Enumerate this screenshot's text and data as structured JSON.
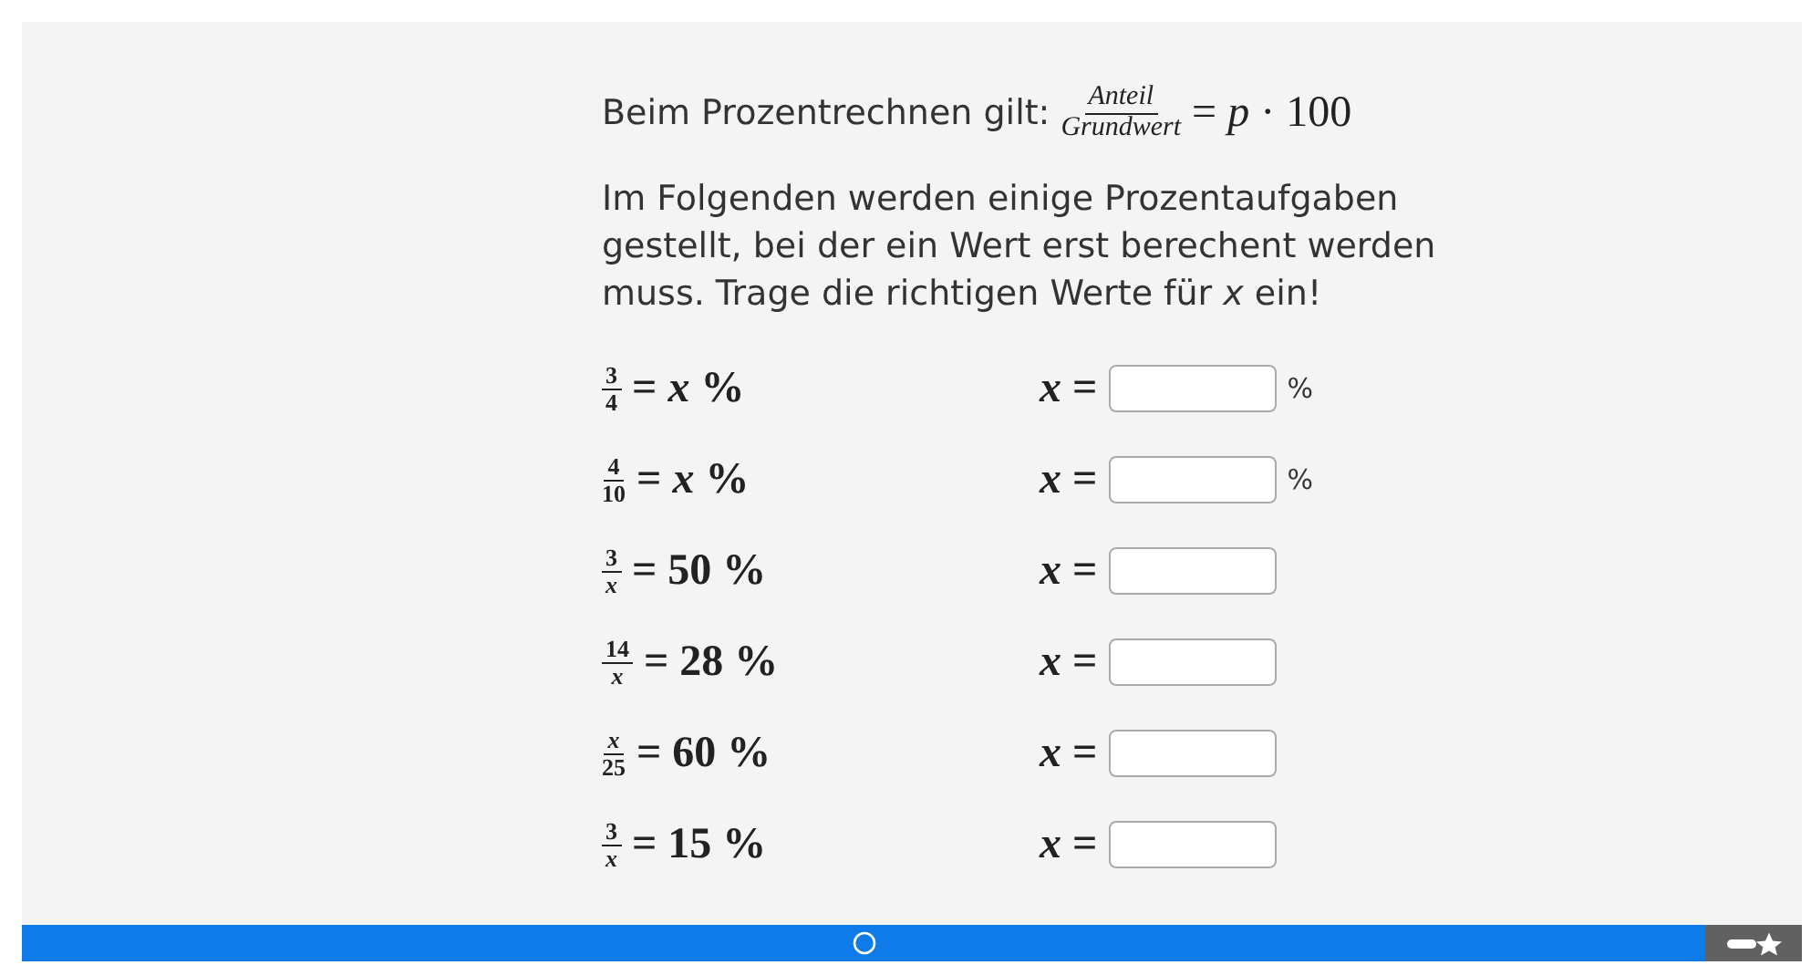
{
  "intro": {
    "text": "Beim Prozentrechnen gilt:",
    "formula": {
      "numerator": "*Anteil*",
      "denominator": "*Grundwert*",
      "rest": "= *p* · 100"
    }
  },
  "instruction": "Im Folgenden werden einige Prozentaufgaben gestellt, bei der ein Wert erst berechent werden muss. Trage die richtigen Werte für *x* ein!",
  "tasks": [
    {
      "numerator": "3",
      "denominator": "4",
      "rest": "= *x* %",
      "answer_label": "*x* =",
      "unit": "%"
    },
    {
      "numerator": "4",
      "denominator": "10",
      "rest": "= *x* %",
      "answer_label": "*x* =",
      "unit": "%"
    },
    {
      "numerator": "3",
      "denominator": "*x*",
      "rest": "= 50 %",
      "answer_label": "*x* ="
    },
    {
      "numerator": "14",
      "denominator": "*x*",
      "rest": "= 28 %",
      "answer_label": "*x* ="
    },
    {
      "numerator": "*x*",
      "denominator": "25",
      "rest": "= 60 %",
      "answer_label": "*x* ="
    },
    {
      "numerator": "3",
      "denominator": "*x*",
      "rest": "= 15 %",
      "answer_label": "*x* ="
    }
  ]
}
